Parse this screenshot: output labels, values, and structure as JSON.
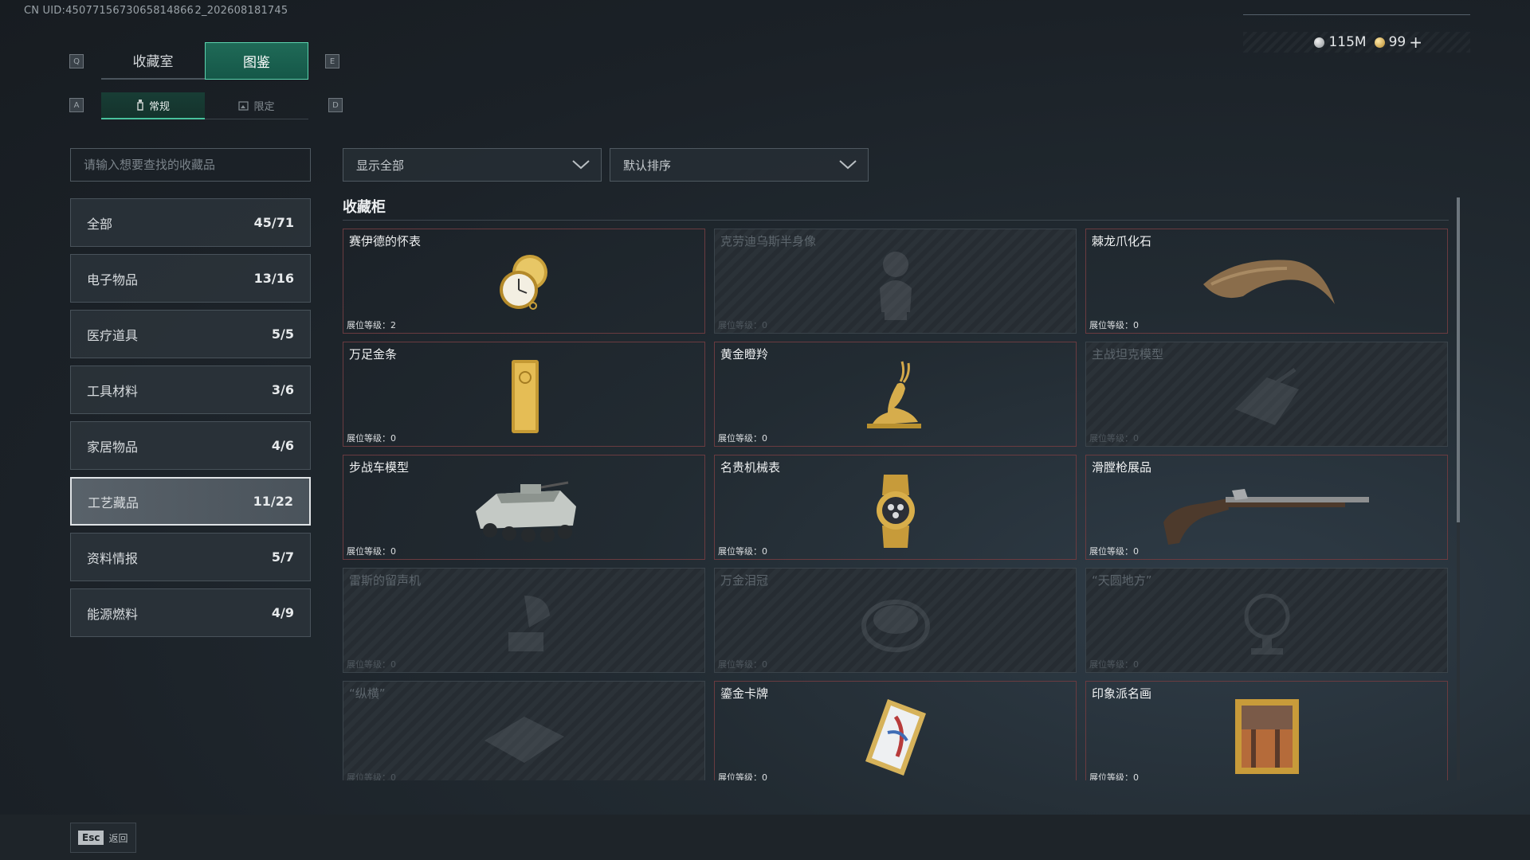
{
  "uid_text": "CN UID:4507715673065814866 2_202608181745",
  "top_tabs": [
    {
      "label": "收藏室",
      "active": false
    },
    {
      "label": "图鉴",
      "active": true
    }
  ],
  "tab_keys": {
    "left": "Q",
    "right": "E"
  },
  "sub_tabs": [
    {
      "label": "常规",
      "active": true
    },
    {
      "label": "限定",
      "active": false
    }
  ],
  "sub_tab_keys": {
    "left": "A",
    "right": "D"
  },
  "currency": {
    "silver": "115M",
    "gold": "99",
    "plus": "+"
  },
  "search": {
    "placeholder": "请输入想要查找的收藏品"
  },
  "filters": {
    "show": "显示全部",
    "sort": "默认排序"
  },
  "categories": [
    {
      "name": "全部",
      "count": "45/71"
    },
    {
      "name": "电子物品",
      "count": "13/16"
    },
    {
      "name": "医疗道具",
      "count": "5/5"
    },
    {
      "name": "工具材料",
      "count": "3/6"
    },
    {
      "name": "家居物品",
      "count": "4/6"
    },
    {
      "name": "工艺藏品",
      "count": "11/22",
      "active": true
    },
    {
      "name": "资料情报",
      "count": "5/7"
    },
    {
      "name": "能源燃料",
      "count": "4/9"
    }
  ],
  "section_title": "收藏柜",
  "level_label": "展位等级：",
  "items": [
    {
      "name": "赛伊德的怀表",
      "level": "2",
      "owned": true,
      "icon": "pocket-watch-icon"
    },
    {
      "name": "克劳迪乌斯半身像",
      "level": "0",
      "owned": false,
      "icon": "bust-icon"
    },
    {
      "name": "棘龙爪化石",
      "level": "0",
      "owned": true,
      "icon": "claw-fossil-icon"
    },
    {
      "name": "万足金条",
      "level": "0",
      "owned": true,
      "icon": "gold-bar-icon"
    },
    {
      "name": "黄金瞪羚",
      "level": "0",
      "owned": true,
      "icon": "gazelle-icon"
    },
    {
      "name": "主战坦克模型",
      "level": "0",
      "owned": false,
      "icon": "tank-model-icon"
    },
    {
      "name": "步战车模型",
      "level": "0",
      "owned": true,
      "icon": "ifv-model-icon"
    },
    {
      "name": "名贵机械表",
      "level": "0",
      "owned": true,
      "icon": "wristwatch-icon"
    },
    {
      "name": "滑膛枪展品",
      "level": "0",
      "owned": true,
      "icon": "musket-icon"
    },
    {
      "name": "雷斯的留声机",
      "level": "0",
      "owned": false,
      "icon": "gramophone-icon"
    },
    {
      "name": "万金泪冠",
      "level": "0",
      "owned": false,
      "icon": "crown-icon"
    },
    {
      "name": "“天圆地方”",
      "level": "0",
      "owned": false,
      "icon": "globe-icon"
    },
    {
      "name": "“纵横”",
      "level": "0",
      "owned": false,
      "icon": "chessboard-icon"
    },
    {
      "name": "鎏金卡牌",
      "level": "0",
      "owned": true,
      "icon": "gilded-card-icon"
    },
    {
      "name": "印象派名画",
      "level": "0",
      "owned": true,
      "icon": "painting-icon"
    }
  ],
  "back": {
    "key": "Esc",
    "label": "返回"
  },
  "colors": {
    "accent": "#48c29d",
    "owned_card": "#5a2a2f",
    "locked_card": "#283036"
  }
}
